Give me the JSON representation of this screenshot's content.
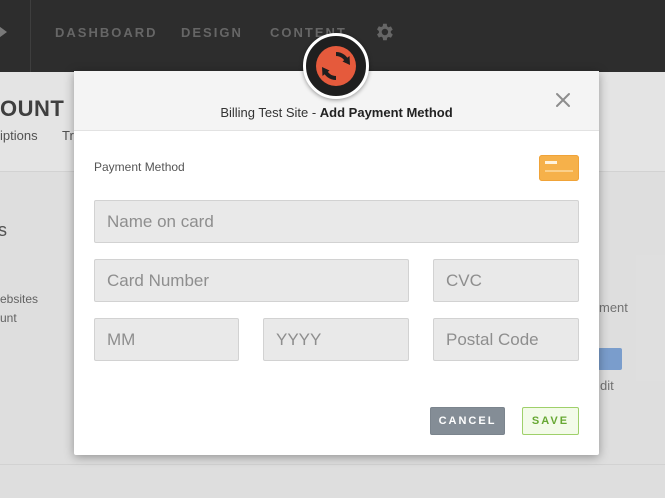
{
  "topbar": {
    "nav": [
      "DASHBOARD",
      "DESIGN",
      "CONTENT"
    ]
  },
  "background": {
    "account_title": "OUNT",
    "subtabs": [
      "iptions",
      "Tr"
    ],
    "side_lines": [
      "ebsites",
      "unt"
    ],
    "side_letter": "s",
    "right_labels": [
      "ment",
      "dit"
    ]
  },
  "modal": {
    "title_prefix": "Billing Test Site - ",
    "title_bold": "Add Payment Method",
    "payment_method_label": "Payment Method",
    "fields": {
      "name_on_card": "Name on card",
      "card_number": "Card Number",
      "cvc": "CVC",
      "mm": "MM",
      "yyyy": "YYYY",
      "postal_code": "Postal Code"
    },
    "cancel_label": "CANCEL",
    "save_label": "SAVE"
  },
  "colors": {
    "logo_accent": "#e55a3c",
    "card_brand": "#f6b14a",
    "save_green": "#67a833",
    "cancel_gray": "#848d96"
  },
  "icons": {
    "logo": "refresh-cycle-icon",
    "close": "close-icon",
    "settings": "gear-icon",
    "card": "credit-card-icon"
  }
}
